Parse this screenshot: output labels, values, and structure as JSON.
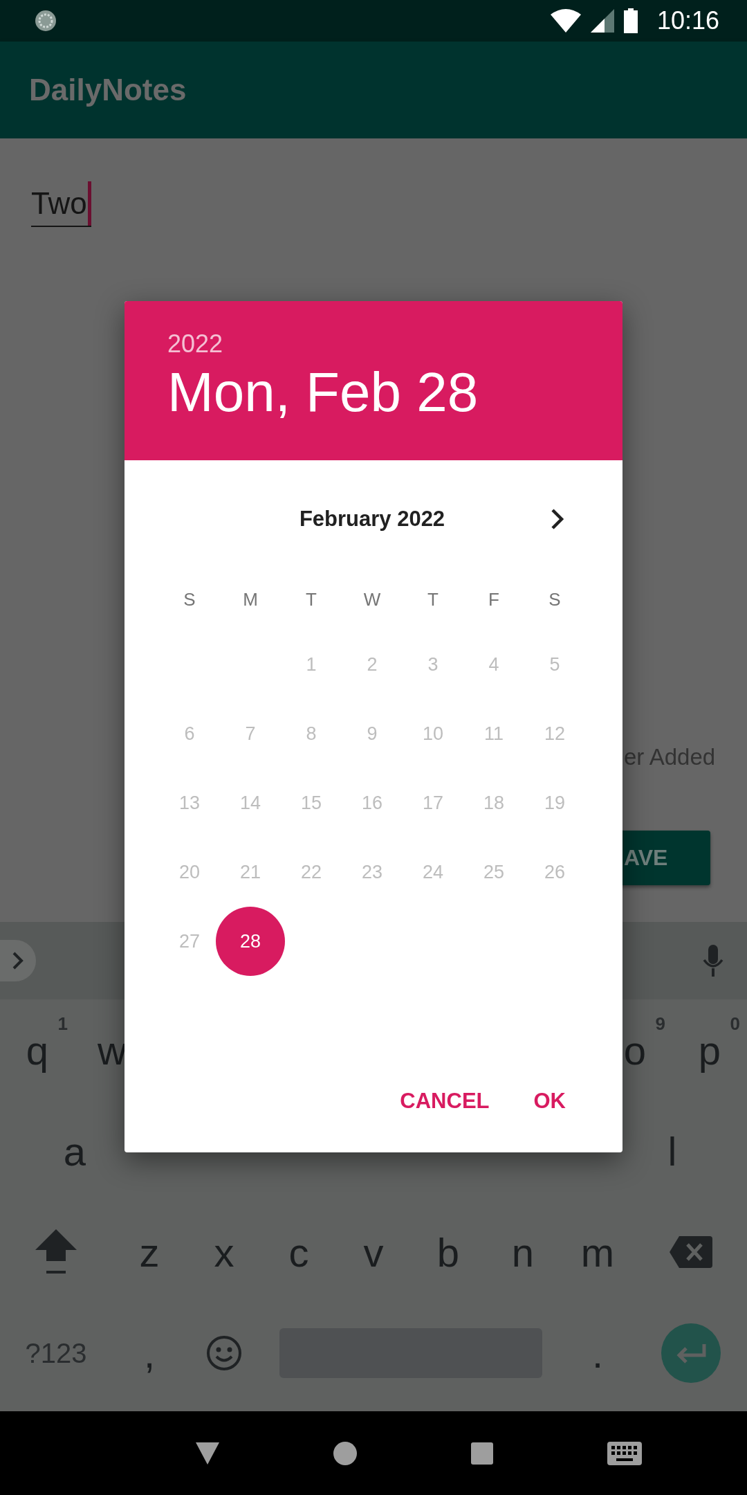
{
  "status_bar": {
    "time": "10:16"
  },
  "app_bar": {
    "title": "DailyNotes"
  },
  "note_field": {
    "value": "Two"
  },
  "background_label": "er Added",
  "background_button": {
    "label": "AVE"
  },
  "date_picker": {
    "year": "2022",
    "date": "Mon, Feb 28",
    "month": "February 2022",
    "weekdays": [
      "S",
      "M",
      "T",
      "W",
      "T",
      "F",
      "S"
    ],
    "weeks": [
      [
        {
          "label": "1",
          "selected": false,
          "disabled": true
        },
        {
          "label": "2",
          "selected": false,
          "disabled": true
        },
        {
          "label": "3",
          "selected": false,
          "disabled": true
        },
        {
          "label": "4",
          "selected": false,
          "disabled": true
        },
        {
          "label": "5",
          "selected": false,
          "disabled": true
        }
      ],
      [
        {
          "label": "6",
          "selected": false,
          "disabled": true
        },
        {
          "label": "7",
          "selected": false,
          "disabled": true
        },
        {
          "label": "8",
          "selected": false,
          "disabled": true
        },
        {
          "label": "9",
          "selected": false,
          "disabled": true
        },
        {
          "label": "10",
          "selected": false,
          "disabled": true
        },
        {
          "label": "11",
          "selected": false,
          "disabled": true
        },
        {
          "label": "12",
          "selected": false,
          "disabled": true
        }
      ],
      [
        {
          "label": "13",
          "selected": false,
          "disabled": true
        },
        {
          "label": "14",
          "selected": false,
          "disabled": true
        },
        {
          "label": "15",
          "selected": false,
          "disabled": true
        },
        {
          "label": "16",
          "selected": false,
          "disabled": true
        },
        {
          "label": "17",
          "selected": false,
          "disabled": true
        },
        {
          "label": "18",
          "selected": false,
          "disabled": true
        },
        {
          "label": "19",
          "selected": false,
          "disabled": true
        }
      ],
      [
        {
          "label": "20",
          "selected": false,
          "disabled": true
        },
        {
          "label": "21",
          "selected": false,
          "disabled": true
        },
        {
          "label": "22",
          "selected": false,
          "disabled": true
        },
        {
          "label": "23",
          "selected": false,
          "disabled": true
        },
        {
          "label": "24",
          "selected": false,
          "disabled": true
        },
        {
          "label": "25",
          "selected": false,
          "disabled": true
        },
        {
          "label": "26",
          "selected": false,
          "disabled": true
        }
      ],
      [
        {
          "label": "27",
          "selected": false,
          "disabled": true
        },
        {
          "label": "28",
          "selected": true,
          "disabled": false
        }
      ]
    ],
    "buttons": [
      {
        "label": "CANCEL"
      },
      {
        "label": "OK"
      }
    ]
  },
  "keyboard": {
    "rows": [
      {
        "kind": "top",
        "left": [
          {
            "kind": "letter",
            "label": "q",
            "hint": "1"
          },
          {
            "kind": "letter",
            "label": "w"
          }
        ],
        "right": [
          {
            "kind": "letter",
            "label": "o",
            "hint": "9"
          },
          {
            "kind": "letter",
            "label": "p",
            "hint": "0"
          }
        ]
      },
      {
        "kind": "home",
        "left": [
          {
            "kind": "letter",
            "label": "a"
          }
        ],
        "right": [
          {
            "kind": "letter",
            "label": "l"
          }
        ]
      },
      {
        "kind": "shift",
        "keys": [
          {
            "kind": "shift"
          },
          {
            "kind": "letter",
            "label": "z"
          },
          {
            "kind": "letter",
            "label": "x"
          },
          {
            "kind": "letter",
            "label": "c"
          },
          {
            "kind": "letter",
            "label": "v"
          },
          {
            "kind": "letter",
            "label": "b"
          },
          {
            "kind": "letter",
            "label": "n"
          },
          {
            "kind": "letter",
            "label": "m"
          },
          {
            "kind": "backspace"
          }
        ]
      },
      {
        "kind": "space",
        "keys": [
          {
            "kind": "symbols",
            "label": "?123"
          },
          {
            "kind": "letter",
            "label": ","
          },
          {
            "kind": "emoji"
          },
          {
            "kind": "space"
          },
          {
            "kind": "letter",
            "label": "."
          },
          {
            "kind": "enter"
          }
        ]
      }
    ]
  }
}
